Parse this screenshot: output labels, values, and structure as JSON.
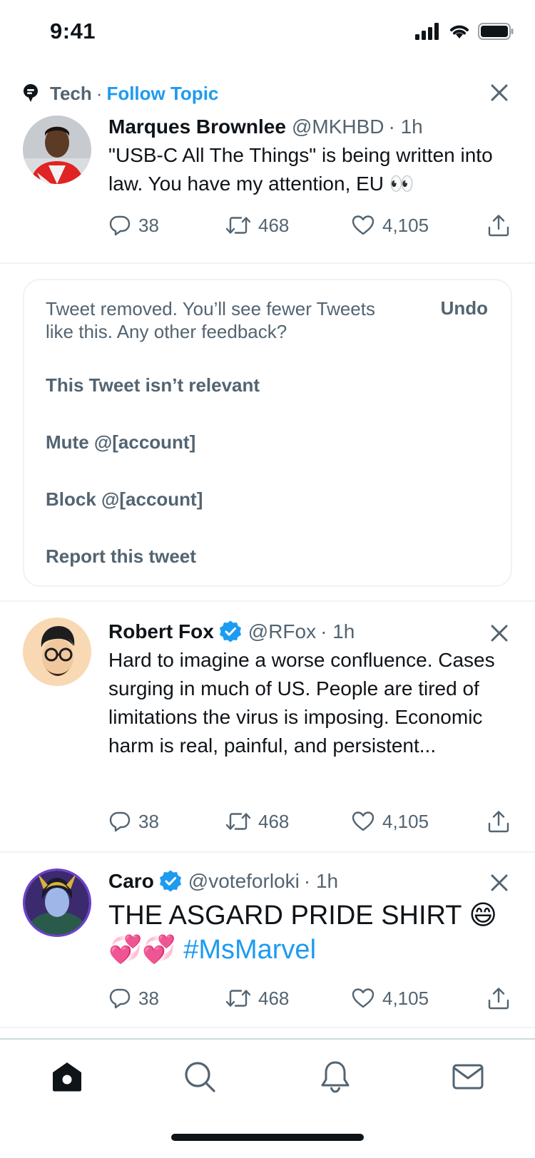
{
  "status_bar": {
    "time": "9:41"
  },
  "topic": {
    "name": "Tech",
    "separator": "·",
    "follow_label": "Follow Topic"
  },
  "tweets": [
    {
      "name": "Marques Brownlee",
      "handle": "@MKHBD",
      "time": "· 1h",
      "verified": false,
      "text": "\"USB-C All The Things\" is being written into law. You have my attention, EU 👀",
      "replies": "38",
      "retweets": "468",
      "likes": "4,105"
    },
    {
      "name": "Robert Fox",
      "handle": "@RFox",
      "time": "· 1h",
      "verified": true,
      "text": "Hard to imagine a worse confluence. Cases surging in much of US. People are tired of limitations the virus is imposing. Economic harm is real, painful, and persistent...",
      "replies": "38",
      "retweets": "468",
      "likes": "4,105"
    },
    {
      "name": "Caro",
      "handle": "@voteforloki",
      "time": "· 1h",
      "verified": true,
      "text": "THE ASGARD PRIDE SHIRT 😄",
      "text_emoji_line": "💞💞",
      "hashtag": "#MsMarvel",
      "replies": "38",
      "retweets": "468",
      "likes": "4,105"
    }
  ],
  "removed": {
    "message": "Tweet removed. You’ll see fewer Tweets like this. Any other feedback?",
    "undo_label": "Undo",
    "options": [
      "This Tweet isn’t relevant",
      "Mute @[account]",
      "Block @[account]",
      "Report this tweet"
    ]
  },
  "bottom_nav": [
    "home-icon",
    "search-icon",
    "bell-icon",
    "mail-icon"
  ],
  "colors": {
    "accent": "#1d9bf0",
    "text_primary": "#0f1419",
    "text_secondary": "#536471",
    "divider": "#eff3f4"
  }
}
